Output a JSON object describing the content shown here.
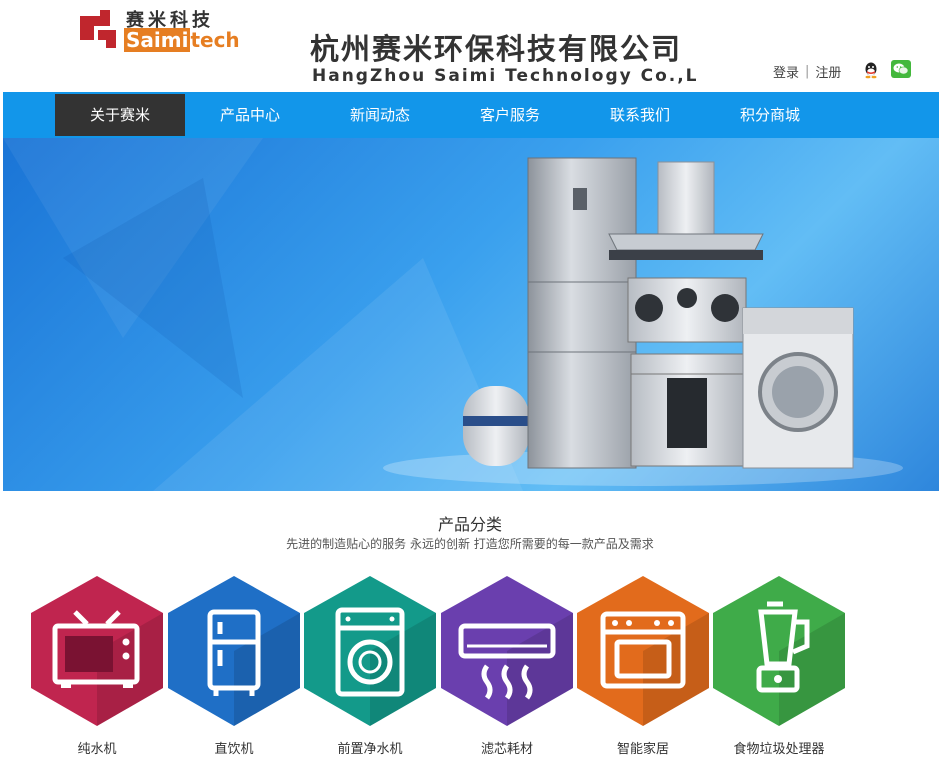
{
  "brand": {
    "logo_cn": "赛米科技",
    "logo_en_a": "Saimi",
    "logo_en_b": "tech",
    "company_cn": "杭州赛米环保科技有限公司",
    "company_en": "HangZhou Saimi Technology Co.,L"
  },
  "auth": {
    "login": "登录",
    "register": "注册"
  },
  "nav": {
    "items": [
      {
        "label": "关于赛米"
      },
      {
        "label": "产品中心"
      },
      {
        "label": "新闻动态"
      },
      {
        "label": "客户服务"
      },
      {
        "label": "联系我们"
      },
      {
        "label": "积分商城"
      }
    ],
    "active_index": 0
  },
  "products": {
    "title": "产品分类",
    "subtitle": "先进的制造贴心的服务 永远的创新 打造您所需要的每一款产品及需求",
    "categories": [
      {
        "label": "纯水机",
        "icon": "tv-icon",
        "color": "#c0254f"
      },
      {
        "label": "直饮机",
        "icon": "fridge-icon",
        "color": "#1f6fc6"
      },
      {
        "label": "前置净水机",
        "icon": "washer-icon",
        "color": "#139a8a"
      },
      {
        "label": "滤芯耗材",
        "icon": "air-conditioner-icon",
        "color": "#6a3fae"
      },
      {
        "label": "智能家居",
        "icon": "oven-icon",
        "color": "#e26b1c"
      },
      {
        "label": "食物垃圾处理器",
        "icon": "blender-icon",
        "color": "#3fab49"
      }
    ]
  },
  "colors": {
    "nav_bg": "#1296ea",
    "nav_active": "#333333",
    "accent": "#e67e22"
  }
}
